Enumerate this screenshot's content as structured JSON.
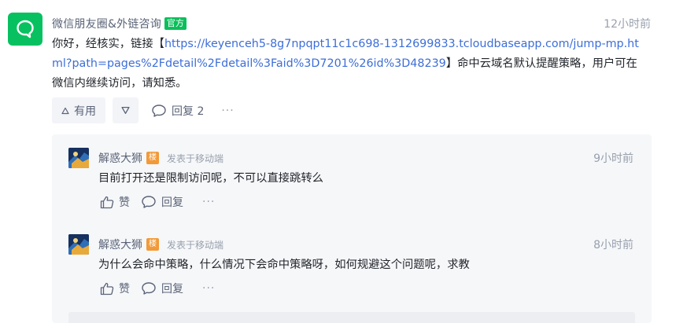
{
  "answer": {
    "author": "微信朋友圈&外链咨询",
    "badge": "官方",
    "time": "12小时前",
    "text_before": "你好，经核实，链接【",
    "link": "https://keyenceh5-8g7npqpt11c1c698-1312699833.tcloudbaseapp.com/jump-mp.html?path=pages%2Fdetail%2Fdetail%3Faid%3D7201%26id%3D48239",
    "text_after": "】命中云域名默认提醒策略，用户可在微信内继续访问，请知悉。",
    "useful_label": "有用",
    "reply_label": "回复 2",
    "more": "···"
  },
  "replies": [
    {
      "name": "解惑大狮",
      "floor_badge": "楼",
      "source": "发表于移动端",
      "time": "9小时前",
      "text": "目前打开还是限制访问呢，不可以直接跳转么",
      "like_label": "赞",
      "reply_label": "回复",
      "more": "···"
    },
    {
      "name": "解惑大狮",
      "floor_badge": "楼",
      "source": "发表于移动端",
      "time": "8小时前",
      "text": "为什么会命中策略，什么情况下会命中策略呀，如何规避这个问题呢，求教",
      "like_label": "赞",
      "reply_label": "回复",
      "more": "···"
    }
  ],
  "colors": {
    "brand_green": "#07c160",
    "badge_green": "#0abf5b",
    "link_blue": "#3c6ed8",
    "floor_orange": "#f29a38"
  }
}
